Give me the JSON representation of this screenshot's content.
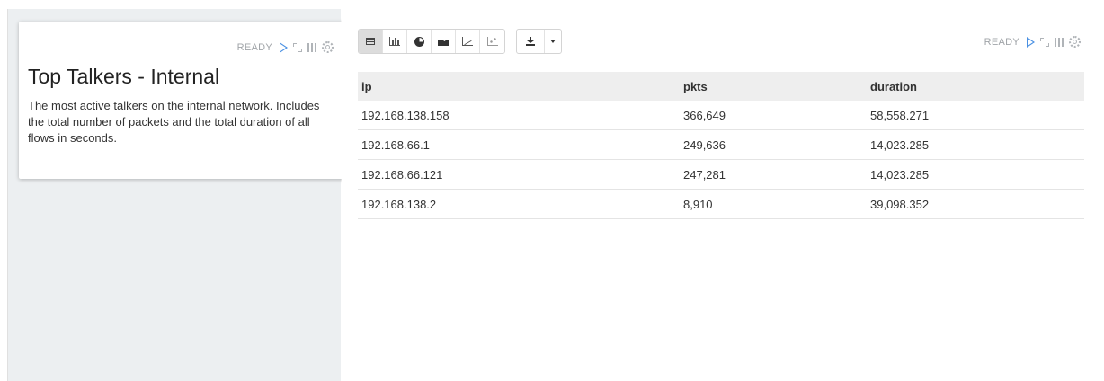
{
  "left_panel": {
    "status": "READY",
    "title": "Top Talkers - Internal",
    "description": "The most active talkers on the internal network. Includes the total number of packets and the total duration of all flows in seconds."
  },
  "right_panel": {
    "status": "READY",
    "toolbar": {
      "visualizations": [
        {
          "name": "table",
          "icon": "table-icon",
          "active": true
        },
        {
          "name": "bar",
          "icon": "bar-chart-icon",
          "active": false
        },
        {
          "name": "pie",
          "icon": "pie-chart-icon",
          "active": false
        },
        {
          "name": "area",
          "icon": "area-chart-icon",
          "active": false
        },
        {
          "name": "line",
          "icon": "line-chart-icon",
          "active": false
        },
        {
          "name": "scatter",
          "icon": "scatter-chart-icon",
          "active": false
        }
      ],
      "download_icon": "download-icon"
    },
    "table": {
      "columns": [
        "ip",
        "pkts",
        "duration"
      ],
      "rows": [
        [
          "192.168.138.158",
          "366,649",
          "58,558.271"
        ],
        [
          "192.168.66.1",
          "249,636",
          "14,023.285"
        ],
        [
          "192.168.66.121",
          "247,281",
          "14,023.285"
        ],
        [
          "192.168.138.2",
          "8,910",
          "39,098.352"
        ]
      ]
    }
  },
  "colors": {
    "accent": "#4a90e2",
    "left_background": "#eceff1",
    "header_background": "#eeeeee"
  }
}
